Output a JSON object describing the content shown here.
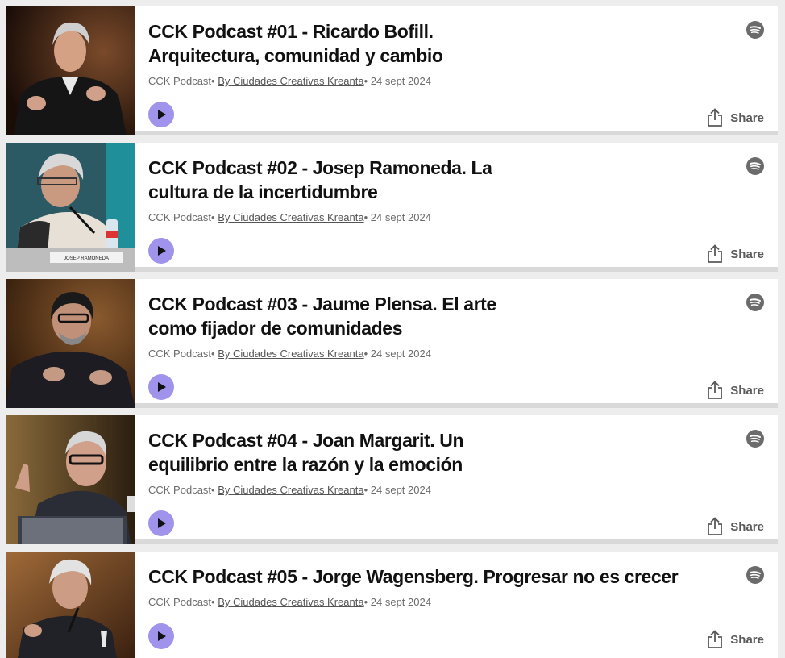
{
  "episodes": [
    {
      "title": "CCK Podcast #01 - Ricardo Bofill. Arquitectura, comunidad y cambio",
      "show": "CCK Podcast",
      "separator1": "• ",
      "author": "By Ciudades Creativas Kreanta",
      "separator2": "• ",
      "date": "24 sept 2024",
      "share_label": "Share",
      "thumb_caption": ""
    },
    {
      "title": "CCK Podcast #02 - Josep Ramoneda. La cultura de la incertidumbre",
      "show": "CCK Podcast",
      "separator1": "• ",
      "author": "By Ciudades Creativas Kreanta",
      "separator2": "• ",
      "date": "24 sept 2024",
      "share_label": "Share",
      "thumb_caption": "JOSEP RAMONEDA"
    },
    {
      "title": "CCK Podcast #03 - Jaume Plensa. El arte como fijador de comunidades",
      "show": "CCK Podcast",
      "separator1": "• ",
      "author": "By Ciudades Creativas Kreanta",
      "separator2": "• ",
      "date": "24 sept 2024",
      "share_label": "Share",
      "thumb_caption": ""
    },
    {
      "title": "CCK Podcast #04 - Joan Margarit. Un equilibrio entre la razón y la emoción",
      "show": "CCK Podcast",
      "separator1": "• ",
      "author": "By Ciudades Creativas Kreanta",
      "separator2": "• ",
      "date": "24 sept 2024",
      "share_label": "Share",
      "thumb_caption": ""
    },
    {
      "title": "CCK Podcast #05 - Jorge Wagensberg. Progresar no es crecer",
      "show": "CCK Podcast",
      "separator1": "• ",
      "author": "By Ciudades Creativas Kreanta",
      "separator2": "• ",
      "date": "24 sept 2024",
      "share_label": "Share",
      "thumb_caption": ""
    }
  ],
  "colors": {
    "play_button": "#a093ec",
    "card_bg": "#ffffff",
    "page_bg": "#ededed",
    "title": "#111111",
    "meta": "#6b6b6b"
  },
  "icons": {
    "play": "play-icon",
    "spotify": "spotify-icon",
    "share": "share-icon"
  }
}
